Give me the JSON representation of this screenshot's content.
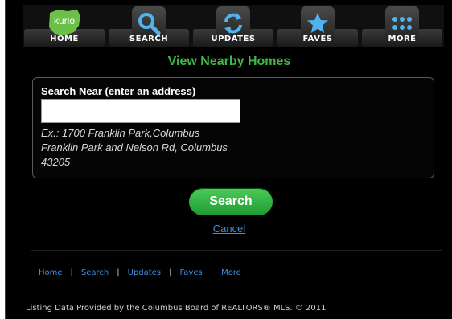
{
  "nav": {
    "items": [
      {
        "label": "HOME",
        "icon": "kurio-logo-icon",
        "logo_text": "kurio"
      },
      {
        "label": "SEARCH",
        "icon": "magnifier-icon"
      },
      {
        "label": "UPDATES",
        "icon": "refresh-icon"
      },
      {
        "label": "FAVES",
        "icon": "star-icon"
      },
      {
        "label": "MORE",
        "icon": "grid-dots-icon"
      }
    ]
  },
  "page_title": "View Nearby Homes",
  "search_form": {
    "label": "Search Near (enter an address)",
    "input_value": "",
    "example": "Ex.: 1700 Franklin Park,Columbus\nFranklin Park and Nelson Rd, Columbus\n43205",
    "search_button": "Search",
    "cancel_link": "Cancel"
  },
  "footer": {
    "links": [
      "Home",
      "Search",
      "Updates",
      "Faves",
      "More"
    ],
    "separator": "|",
    "disclaimer": "Listing Data Provided by the Columbus Board of REALTORS® MLS. © 2011"
  },
  "colors": {
    "accent_green": "#3fb845",
    "link_blue": "#3f8fe0",
    "background": "#000000"
  }
}
